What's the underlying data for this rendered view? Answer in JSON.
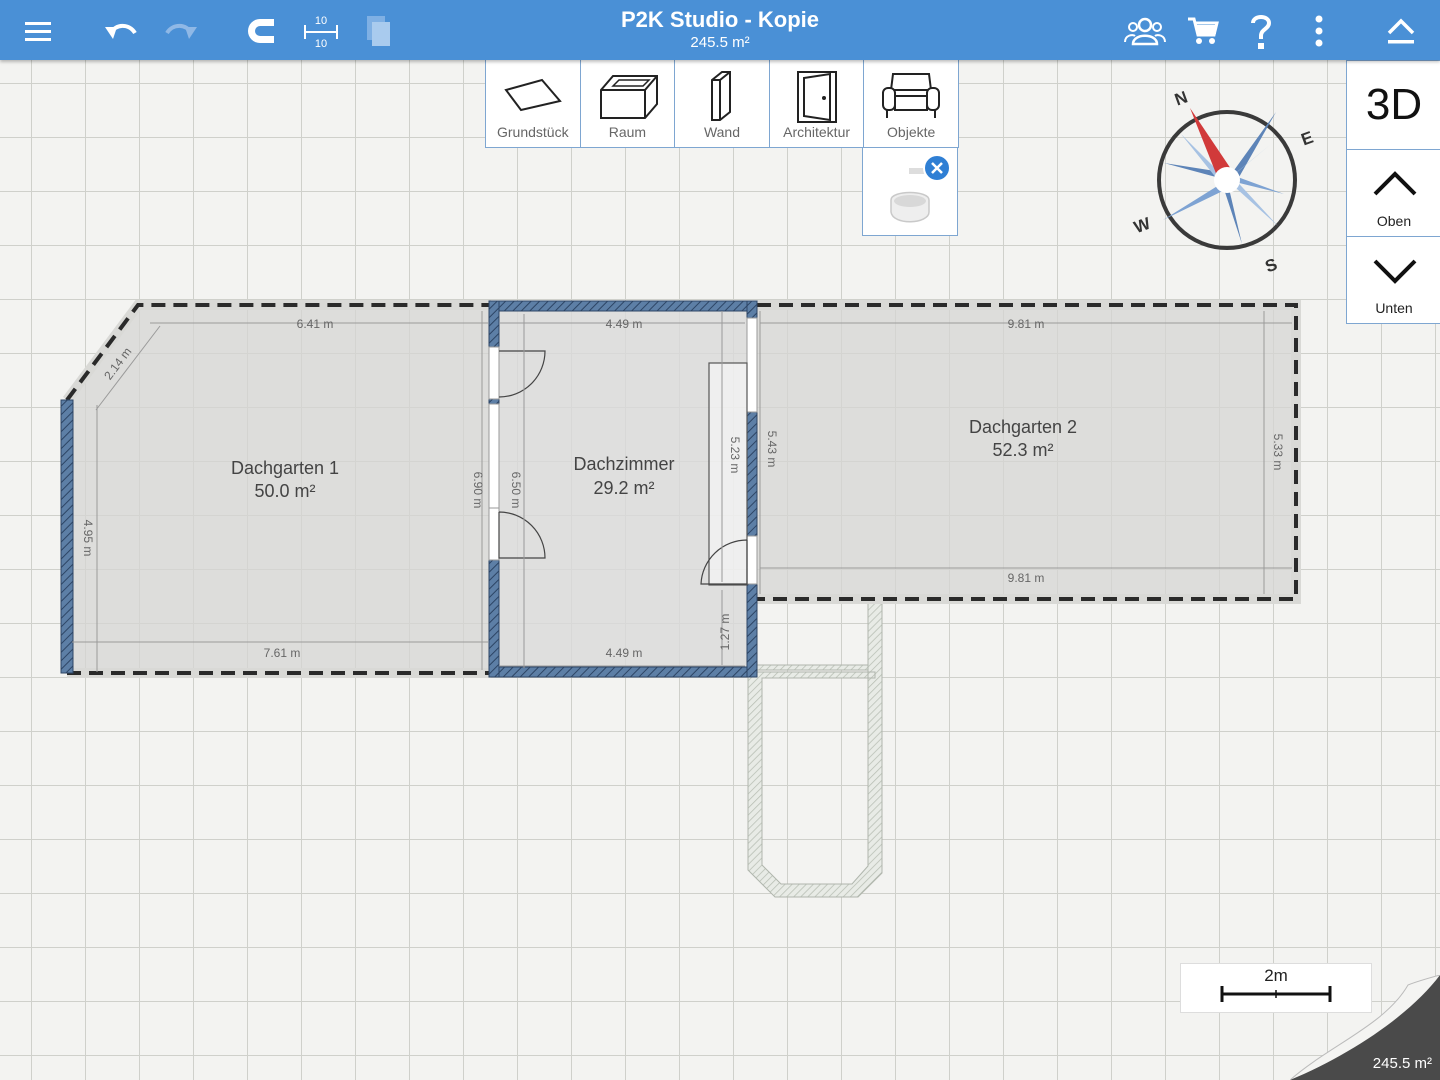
{
  "topbar": {
    "title": "P2K Studio - Kopie",
    "area": "245.5 m²",
    "snap_label_top": "10",
    "snap_label_bottom": "10",
    "icons": [
      "menu-icon",
      "undo-icon",
      "redo-icon",
      "magnet-icon",
      "grid-size-icon",
      "layers-icon",
      "people-icon",
      "cart-icon",
      "help-icon",
      "more-icon",
      "collapse-icon"
    ],
    "background": "#4a90d6"
  },
  "tools": [
    {
      "label": "Grundstück",
      "icon": "plot-icon"
    },
    {
      "label": "Raum",
      "icon": "room-icon"
    },
    {
      "label": "Wand",
      "icon": "wall-icon"
    },
    {
      "label": "Architektur",
      "icon": "door-icon"
    },
    {
      "label": "Objekte",
      "icon": "armchair-icon"
    }
  ],
  "object_panel": {
    "icon": "toilet-icon",
    "close_icon": "close-icon"
  },
  "view": {
    "btn_3d": "3D",
    "up_label": "Oben",
    "down_label": "Unten"
  },
  "compass": {
    "n": "N",
    "e": "E",
    "s": "S",
    "w": "W"
  },
  "rooms": [
    {
      "name": "Dachgarten 1",
      "area": "50.0 m²"
    },
    {
      "name": "Dachzimmer",
      "area": "29.2 m²"
    },
    {
      "name": "Dachgarten 2",
      "area": "52.3 m²"
    }
  ],
  "dims": {
    "g1_top": "6.41 m",
    "g1_diag": "2.14 m",
    "g1_left": "4.95 m",
    "g1_bottom": "7.61 m",
    "g1_right": "6.90 m",
    "dz_top": "4.49 m",
    "dz_left": "6.50 m",
    "dz_bottom": "4.49 m",
    "dz_right": "5.23 m",
    "dz_right_low": "1.27 m",
    "g2_left": "5.43 m",
    "g2_top": "9.81 m",
    "g2_right": "5.33 m",
    "g2_bottom": "9.81 m"
  },
  "scale": {
    "label": "2m"
  },
  "total_area": "245.5 m²"
}
